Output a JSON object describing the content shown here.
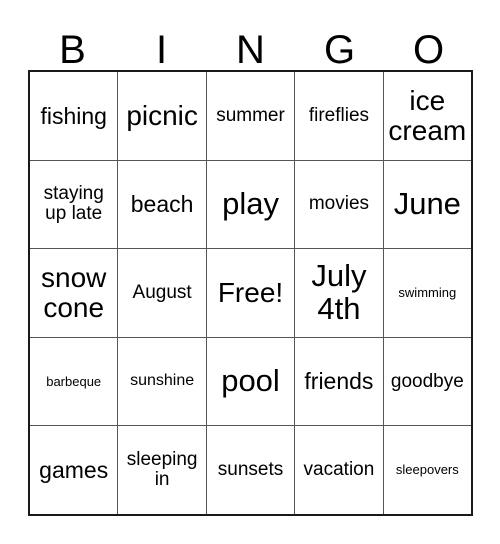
{
  "card": {
    "title": "BINGO",
    "header": {
      "letters": [
        "B",
        "I",
        "N",
        "G",
        "O"
      ]
    },
    "colors": {
      "background": "#ffffff",
      "text": "#000000",
      "outer_border": "#1a1a1a",
      "inner_grid_line": "#555555"
    },
    "grid": {
      "columns": 5,
      "rows": 5,
      "free_space": {
        "row": 2,
        "column": 2,
        "label": "Free!"
      },
      "cells": [
        [
          {
            "label": "fishing",
            "size": "fs-l"
          },
          {
            "label": "picnic",
            "size": "fs-xl"
          },
          {
            "label": "summer",
            "size": "fs-m"
          },
          {
            "label": "fireflies",
            "size": "fs-m"
          },
          {
            "label": "ice\ncream",
            "size": "fs-xl"
          }
        ],
        [
          {
            "label": "staying\nup late",
            "size": "fs-m"
          },
          {
            "label": "beach",
            "size": "fs-l"
          },
          {
            "label": "play",
            "size": "fs-xxl"
          },
          {
            "label": "movies",
            "size": "fs-m"
          },
          {
            "label": "June",
            "size": "fs-xxl"
          }
        ],
        [
          {
            "label": "snow\ncone",
            "size": "fs-xl"
          },
          {
            "label": "August",
            "size": "fs-m"
          },
          {
            "label": "Free!",
            "size": "fs-xl"
          },
          {
            "label": "July\n4th",
            "size": "fs-xxl"
          },
          {
            "label": "swimming",
            "size": "fs-xs"
          }
        ],
        [
          {
            "label": "barbeque",
            "size": "fs-xs"
          },
          {
            "label": "sunshine",
            "size": "fs-s"
          },
          {
            "label": "pool",
            "size": "fs-xxl"
          },
          {
            "label": "friends",
            "size": "fs-l"
          },
          {
            "label": "goodbye",
            "size": "fs-m"
          }
        ],
        [
          {
            "label": "games",
            "size": "fs-l"
          },
          {
            "label": "sleeping\nin",
            "size": "fs-m"
          },
          {
            "label": "sunsets",
            "size": "fs-m"
          },
          {
            "label": "vacation",
            "size": "fs-m"
          },
          {
            "label": "sleepovers",
            "size": "fs-xs"
          }
        ]
      ]
    }
  }
}
